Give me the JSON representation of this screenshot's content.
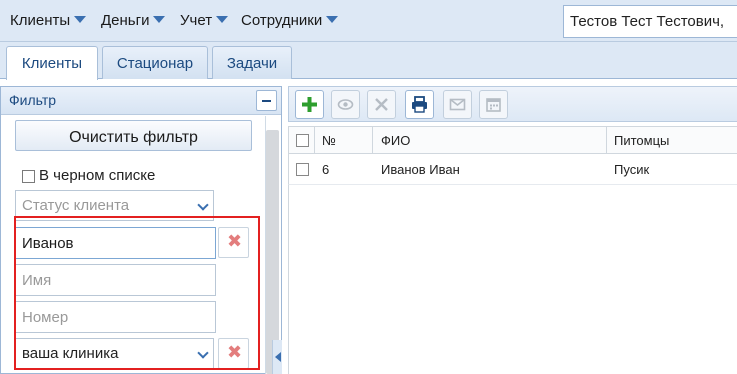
{
  "menu": {
    "items": [
      {
        "label": "Клиенты"
      },
      {
        "label": "Деньги"
      },
      {
        "label": "Учет"
      },
      {
        "label": "Сотрудники"
      }
    ],
    "user": "Тестов Тест Тестович,"
  },
  "tabs": [
    {
      "label": "Клиенты",
      "active": true
    },
    {
      "label": "Стационар",
      "active": false
    },
    {
      "label": "Задачи",
      "active": false
    }
  ],
  "filter": {
    "title": "Фильтр",
    "clear_label": "Очистить фильтр",
    "blacklist_label": "В черном списке",
    "blacklist_checked": false,
    "status_placeholder": "Статус клиента",
    "surname_value": "Иванов",
    "name_placeholder": "Имя",
    "number_placeholder": "Номер",
    "clinic_value": "ваша клиника",
    "clear_field_glyph": "✖"
  },
  "toolbar": {
    "buttons": [
      {
        "name": "add",
        "icon": "plus-icon",
        "enabled": true,
        "color": "#2e9e2e"
      },
      {
        "name": "view",
        "icon": "eye-icon",
        "enabled": false
      },
      {
        "name": "delete",
        "icon": "close-icon",
        "enabled": false
      },
      {
        "name": "print",
        "icon": "printer-icon",
        "enabled": true,
        "color": "#1c4a80"
      },
      {
        "name": "mail",
        "icon": "envelope-icon",
        "enabled": false
      },
      {
        "name": "calendar",
        "icon": "calendar-icon",
        "enabled": false
      }
    ]
  },
  "grid": {
    "columns": [
      "№",
      "ФИО",
      "Питомцы"
    ],
    "rows": [
      {
        "num": "6",
        "fio": "Иванов Иван",
        "pets": "Пусик"
      }
    ]
  },
  "colors": {
    "accent": "#1c4a80",
    "highlight": "#e32020",
    "panel_bg": "#dde8f5"
  }
}
